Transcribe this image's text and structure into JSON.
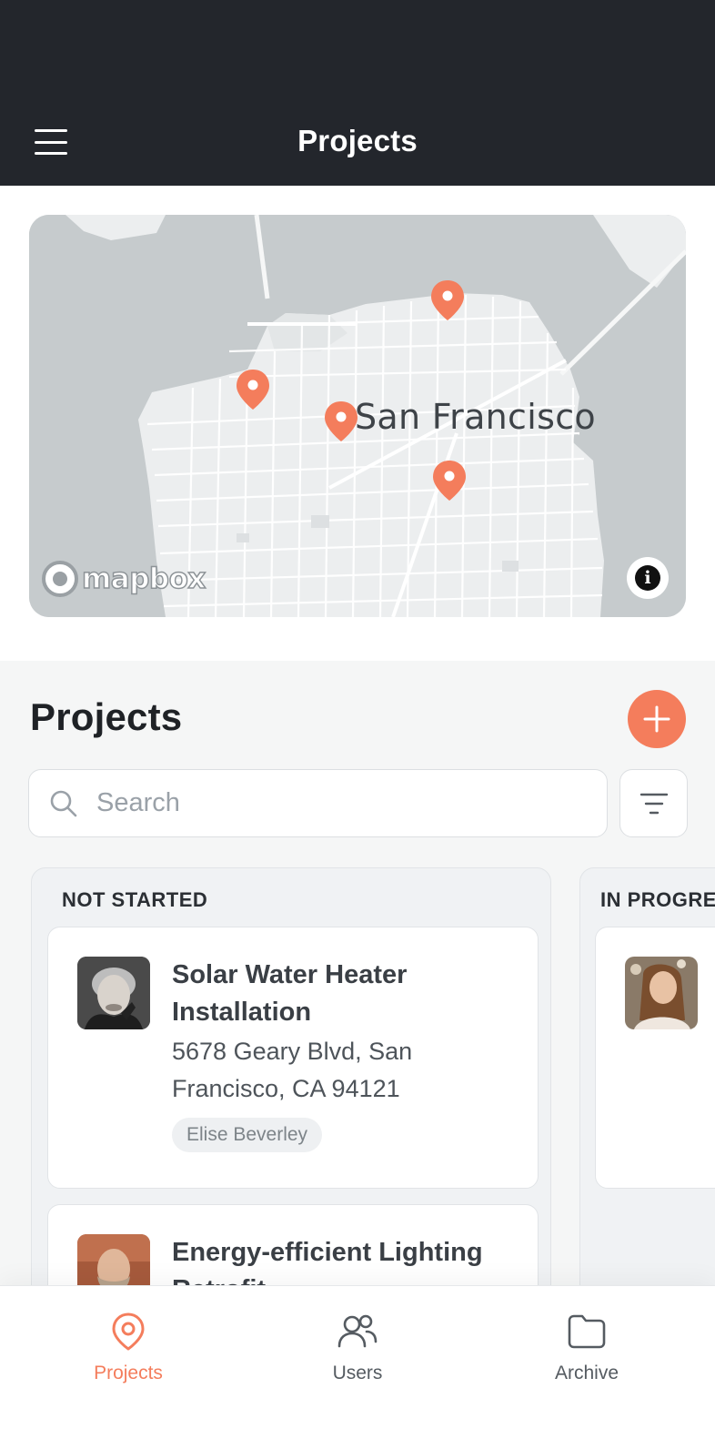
{
  "header": {
    "title": "Projects",
    "menu_icon": "hamburger-menu-icon"
  },
  "map": {
    "city_label": "San Francisco",
    "attribution_logo": "mapbox",
    "pin_color": "#f47d5c",
    "pin_count": 4,
    "info_icon": "info-icon"
  },
  "projects": {
    "title": "Projects",
    "add_icon": "plus-icon",
    "search": {
      "placeholder": "Search",
      "value": ""
    },
    "filter_icon": "filter-icon"
  },
  "columns": [
    {
      "title": "NOT STARTED",
      "cards": [
        {
          "title": "Solar Water Heater Installation",
          "address": "5678 Geary Blvd, San Francisco, CA 94121",
          "assignee": "Elise Beverley",
          "avatar": "avatar-elderly-woman"
        },
        {
          "title": "Energy-efficient Lighting Retrofit",
          "avatar": "avatar-bearded-man"
        }
      ]
    },
    {
      "title": "IN PROGRESS",
      "cards": [
        {
          "avatar": "avatar-smiling-woman"
        }
      ]
    }
  ],
  "bottom_nav": {
    "items": [
      {
        "label": "Projects",
        "icon": "map-pin-icon",
        "active": true
      },
      {
        "label": "Users",
        "icon": "users-icon",
        "active": false
      },
      {
        "label": "Archive",
        "icon": "folder-icon",
        "active": false
      }
    ]
  },
  "colors": {
    "header_bg": "#23262c",
    "accent": "#f47d5c",
    "page_bg": "#f5f6f6"
  }
}
